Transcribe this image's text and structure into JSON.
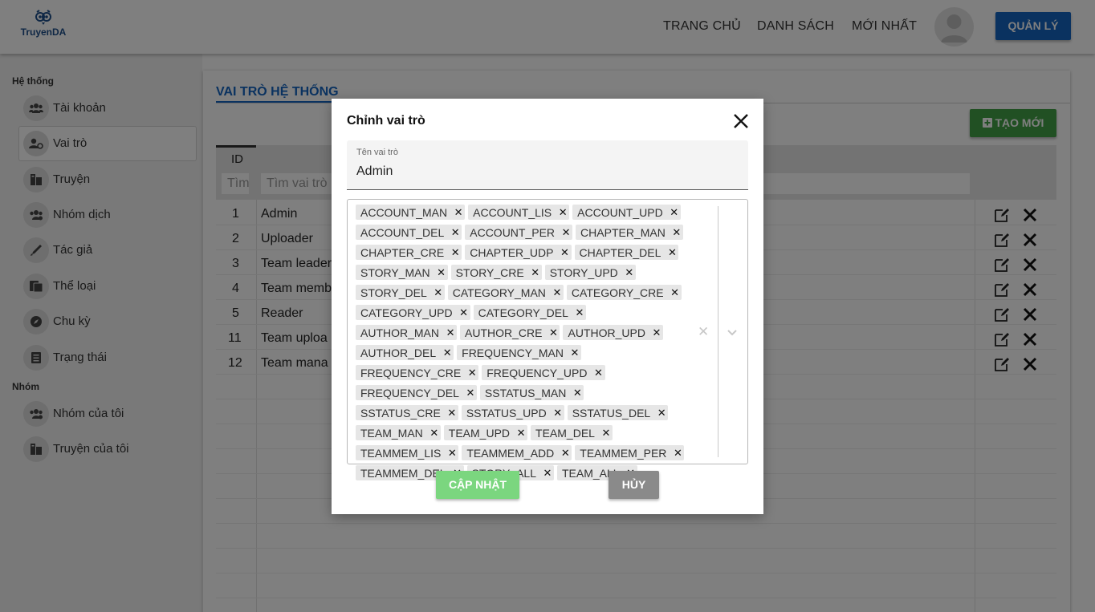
{
  "header": {
    "logo_text": "TruyenDA",
    "nav": [
      "TRANG CHỦ",
      "DANH SÁCH",
      "MỚI NHẤT"
    ],
    "admin_button": "QUẢN LÝ"
  },
  "sidebar": {
    "section_system": "Hệ thống",
    "section_group": "Nhóm",
    "items": [
      {
        "label": "Tài khoản",
        "icon": "users-icon"
      },
      {
        "label": "Vai trò",
        "icon": "user-role-icon"
      },
      {
        "label": "Truyện",
        "icon": "book-icon"
      },
      {
        "label": "Nhóm dịch",
        "icon": "group-icon"
      },
      {
        "label": "Tác giả",
        "icon": "pen-icon"
      },
      {
        "label": "Thể loại",
        "icon": "category-icon"
      },
      {
        "label": "Chu kỳ",
        "icon": "compass-icon"
      },
      {
        "label": "Trạng thái",
        "icon": "status-icon"
      },
      {
        "label": "Nhóm của tôi",
        "icon": "group-icon"
      },
      {
        "label": "Truyện của tôi",
        "icon": "book-icon"
      }
    ]
  },
  "main": {
    "title": "VAI TRÒ HỆ THỐNG",
    "create_button": "TẠO MỚI",
    "table": {
      "id_header": "ID",
      "id_filter_placeholder": "Tìm",
      "name_filter_placeholder": "Tìm vai trò",
      "rows": [
        {
          "id": "1",
          "name": "Admin"
        },
        {
          "id": "2",
          "name": "Uploader"
        },
        {
          "id": "3",
          "name": "Team leader"
        },
        {
          "id": "4",
          "name": "Team memb"
        },
        {
          "id": "5",
          "name": "Reader"
        },
        {
          "id": "11",
          "name": "Team uploa"
        },
        {
          "id": "12",
          "name": "Team mana"
        }
      ]
    }
  },
  "modal": {
    "title": "Chỉnh vai trò",
    "name_label": "Tên vai trò",
    "name_value": "Admin",
    "permissions": [
      "ACCOUNT_MAN",
      "ACCOUNT_LIS",
      "ACCOUNT_UPD",
      "ACCOUNT_DEL",
      "ACCOUNT_PER",
      "CHAPTER_MAN",
      "CHAPTER_CRE",
      "CHAPTER_UDP",
      "CHAPTER_DEL",
      "STORY_MAN",
      "STORY_CRE",
      "STORY_UPD",
      "STORY_DEL",
      "CATEGORY_MAN",
      "CATEGORY_CRE",
      "CATEGORY_UPD",
      "CATEGORY_DEL",
      "AUTHOR_MAN",
      "AUTHOR_CRE",
      "AUTHOR_UPD",
      "AUTHOR_DEL",
      "FREQUENCY_MAN",
      "FREQUENCY_CRE",
      "FREQUENCY_UPD",
      "FREQUENCY_DEL",
      "SSTATUS_MAN",
      "SSTATUS_CRE",
      "SSTATUS_UPD",
      "SSTATUS_DEL",
      "TEAM_MAN",
      "TEAM_UPD",
      "TEAM_DEL",
      "TEAMMEM_LIS",
      "TEAMMEM_ADD",
      "TEAMMEM_PER",
      "TEAMMEM_DEL",
      "STORY_ALL",
      "TEAM_ALL"
    ],
    "update_button": "CẬP NHẬT",
    "cancel_button": "HỦY"
  },
  "colors": {
    "primary": "#1565c0",
    "success": "#43a047",
    "success_light": "#7bd67f",
    "cancel": "#8a8a8a"
  }
}
